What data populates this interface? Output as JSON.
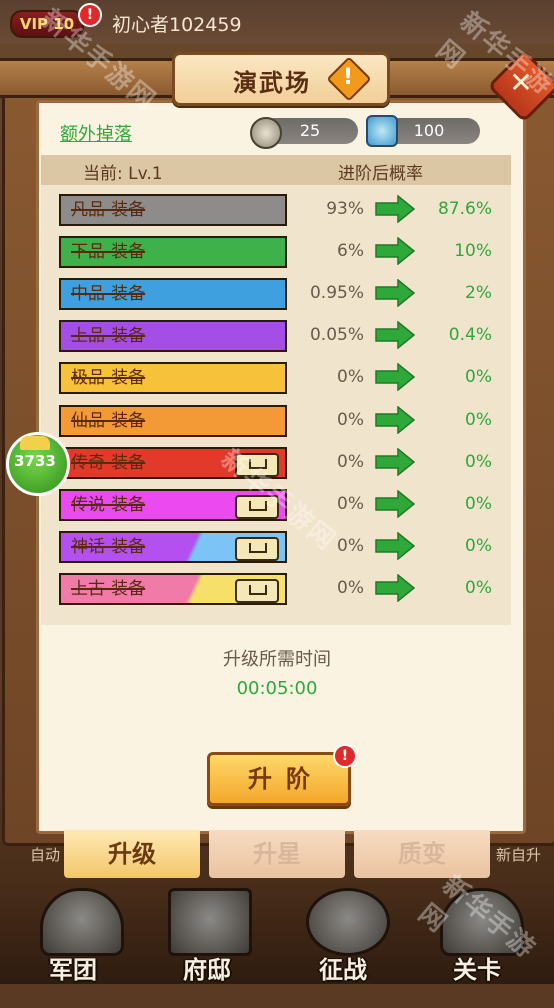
{
  "header": {
    "vip_label": "VIP 10",
    "vip_badge": "!",
    "player_name": "初心者102459"
  },
  "watermarks": [
    "新华手游网",
    "新华手游网",
    "新华手游网",
    "新华手游网"
  ],
  "dialog": {
    "title": "演武场",
    "title_alert": "!",
    "close_icon": "close-cross-icon",
    "extra_drop_link": "额外掉落",
    "resources": [
      {
        "icon": "coin-icon",
        "value": "25"
      },
      {
        "icon": "hourglass-icon",
        "value": "100"
      }
    ],
    "table": {
      "current_header": "当前: Lv.1",
      "next_header": "进阶后概率",
      "rows": [
        {
          "name": "凡品-装备",
          "current": "93%",
          "next": "87.6%",
          "color": "#8e8c8a",
          "color2": "#8e8c8a",
          "locked": false
        },
        {
          "name": "下品-装备",
          "current": "6%",
          "next": "10%",
          "color": "#3fb14a",
          "color2": "#3fb14a",
          "locked": false
        },
        {
          "name": "中品-装备",
          "current": "0.95%",
          "next": "2%",
          "color": "#3fa0e0",
          "color2": "#3fa0e0",
          "locked": false
        },
        {
          "name": "上品-装备",
          "current": "0.05%",
          "next": "0.4%",
          "color": "#a54ee6",
          "color2": "#a54ee6",
          "locked": false
        },
        {
          "name": "极品-装备",
          "current": "0%",
          "next": "0%",
          "color": "#f6c23a",
          "color2": "#f6c23a",
          "locked": false
        },
        {
          "name": "仙品-装备",
          "current": "0%",
          "next": "0%",
          "color": "#f39a36",
          "color2": "#f39a36",
          "locked": false
        },
        {
          "name": "传奇-装备",
          "current": "0%",
          "next": "0%",
          "color": "#e23a2a",
          "color2": "#e23a2a",
          "locked": true
        },
        {
          "name": "传说-装备",
          "current": "0%",
          "next": "0%",
          "color": "#ea4af0",
          "color2": "#ea4af0",
          "locked": true
        },
        {
          "name": "神话-装备",
          "current": "0%",
          "next": "0%",
          "color": "#b44ff0",
          "color2": "#7cc4f5",
          "locked": true
        },
        {
          "name": "上古-装备",
          "current": "0%",
          "next": "0%",
          "color": "#f07aa8",
          "color2": "#f6e06a",
          "locked": true
        }
      ]
    },
    "time_label": "升级所需时间",
    "time_value": "00:05:00",
    "upgrade_button": "升阶",
    "upgrade_badge": "!"
  },
  "tabs": [
    {
      "label": "升级",
      "active": true
    },
    {
      "label": "升星",
      "active": false
    },
    {
      "label": "质变",
      "active": false
    }
  ],
  "side_texts": [
    "自动",
    "新自升"
  ],
  "float_badge": "3733",
  "nav": [
    {
      "label": "军团",
      "icon": "legion-icon"
    },
    {
      "label": "府邸",
      "icon": "mansion-icon"
    },
    {
      "label": "征战",
      "icon": "battle-icon"
    },
    {
      "label": "关卡",
      "icon": "stage-icon"
    }
  ]
}
